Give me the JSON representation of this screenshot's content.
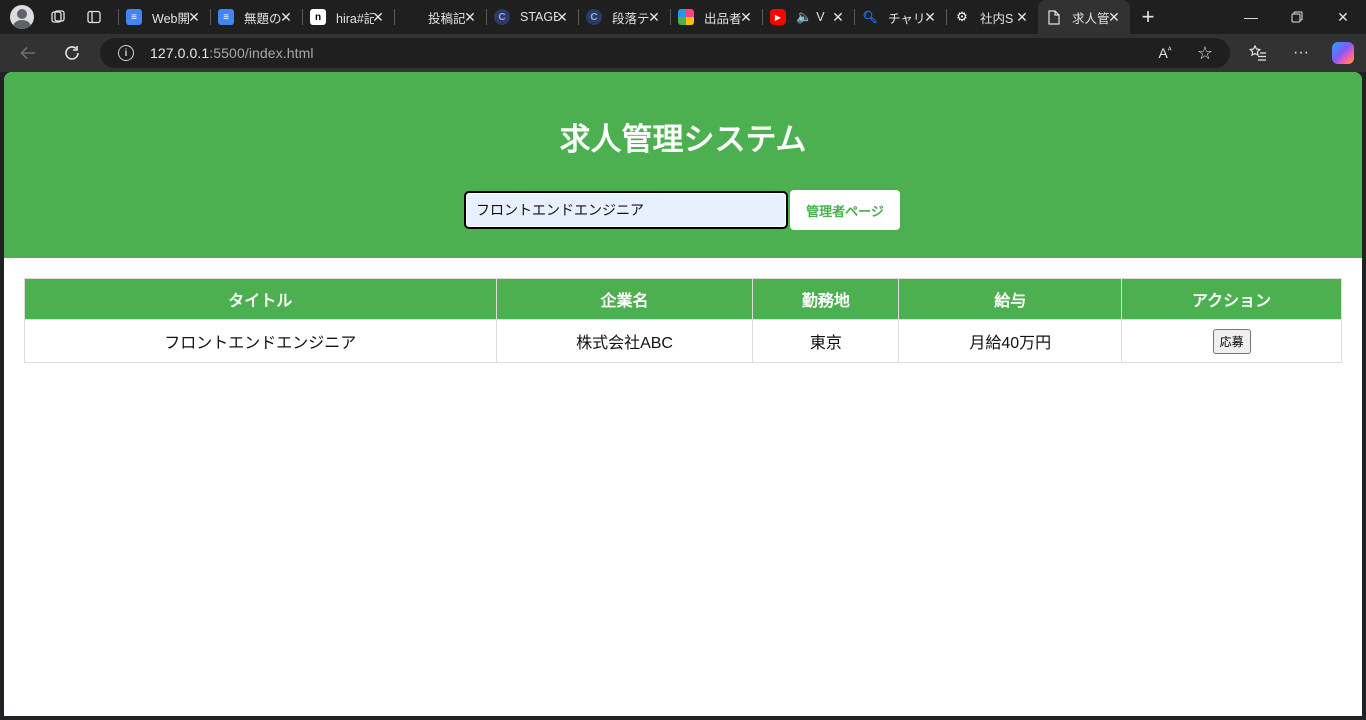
{
  "browser": {
    "tabs": [
      {
        "label": "Web開",
        "favicon": "docs-icon",
        "color": "#4285f4"
      },
      {
        "label": "無題の",
        "favicon": "docs-icon",
        "color": "#4285f4"
      },
      {
        "label": "hira#記",
        "favicon": "note-icon",
        "color": "#ffffff"
      },
      {
        "label": "投稿記",
        "favicon": "blank-icon",
        "color": "#1f1f1f"
      },
      {
        "label": "STAGE",
        "favicon": "stage-icon",
        "color": "#2b3a67"
      },
      {
        "label": "段落テ",
        "favicon": "stage-icon",
        "color": "#2b3a67"
      },
      {
        "label": "出品者",
        "favicon": "color-icon",
        "color": "#ff4081"
      },
      {
        "label": "V",
        "favicon": "youtube-icon",
        "color": "#ff0000"
      },
      {
        "label": "チャリD",
        "favicon": "search-icon",
        "color": "#1a73e8"
      },
      {
        "label": "社内S",
        "favicon": "openai-icon",
        "color": "#ffffff"
      },
      {
        "label": "求人管",
        "favicon": "page-icon",
        "color": "#ffffff"
      }
    ],
    "url_host": "127.0.0.1",
    "url_path": ":5500/index.html"
  },
  "page": {
    "title": "求人管理システム",
    "search_value": "フロントエンドエンジニア",
    "admin_button": "管理者ページ",
    "table": {
      "headers": [
        "タイトル",
        "企業名",
        "勤務地",
        "給与",
        "アクション"
      ],
      "rows": [
        {
          "title": "フロントエンドエンジニア",
          "company": "株式会社ABC",
          "location": "東京",
          "salary": "月給40万円",
          "action": "応募"
        }
      ]
    }
  },
  "colors": {
    "accent": "#4caf50",
    "header_text": "#ffffff"
  }
}
